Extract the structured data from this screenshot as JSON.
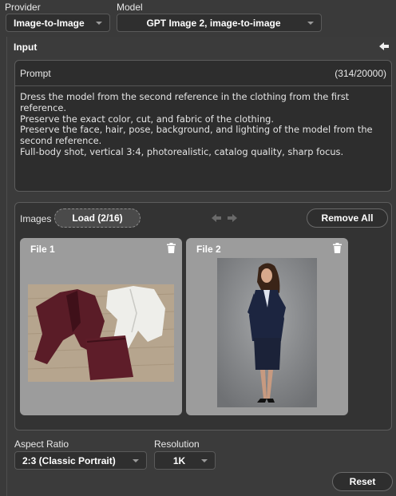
{
  "header": {
    "provider_label": "Provider",
    "provider_value": "Image-to-Image",
    "model_label": "Model",
    "model_value": "GPT Image 2, image-to-image"
  },
  "input": {
    "title": "Input",
    "prompt_label": "Prompt",
    "prompt_counter": "(314/20000)",
    "prompt_text": "Dress the model from the second reference in the clothing from the first reference.\nPreserve the exact color, cut, and fabric of the clothing.\nPreserve the face, hair, pose, background, and lighting of the model from the\nsecond reference.\nFull-body shot, vertical 3:4, photorealistic, catalog quality, sharp focus."
  },
  "images": {
    "label": "Images",
    "load_button": "Load (2/16)",
    "remove_all_button": "Remove All",
    "files": [
      {
        "title": "File 1",
        "description": "burgundy blazer, burgundy skirt and white blouse laid flat on wooden floor"
      },
      {
        "title": "File 2",
        "description": "woman in navy suit jacket and skirt with heels on grey background"
      }
    ]
  },
  "settings": {
    "aspect_label": "Aspect Ratio",
    "aspect_value": "2:3 (Classic Portrait)",
    "resolution_label": "Resolution",
    "resolution_value": "1K"
  },
  "actions": {
    "reset_button": "Reset"
  },
  "icons": [
    "caret-down-icon",
    "collapse-arrow-icon",
    "arrow-left-icon",
    "arrow-right-icon",
    "trash-icon"
  ],
  "colors": {
    "background": "#3a3a3a",
    "field": "#2d2d2d",
    "card": "#9c9c9c",
    "text": "#e6e6e6"
  }
}
